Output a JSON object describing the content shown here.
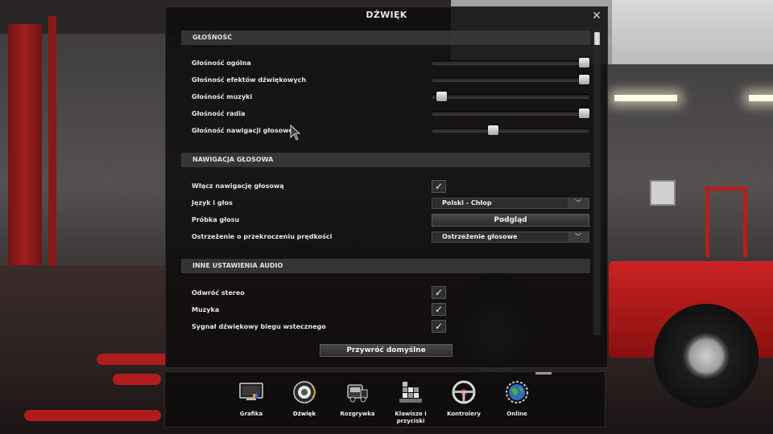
{
  "dialog": {
    "title": "DŹWIĘK",
    "close_glyph": "✕",
    "restore_label": "Przywróć domyślne"
  },
  "sections": {
    "volume": {
      "header": "GŁOŚNOŚĆ",
      "items": [
        {
          "label": "Głośność ogólna",
          "value": 1.0
        },
        {
          "label": "Głośność efektów dźwiękowych",
          "value": 1.0
        },
        {
          "label": "Głośność muzyki",
          "value": 0.03
        },
        {
          "label": "Głośność radia",
          "value": 1.0
        },
        {
          "label": "Głośność nawigacji głosowej",
          "value": 0.38
        }
      ]
    },
    "navigation": {
      "header": "NAWIGACJA GŁOSOWA",
      "enable_label": "Włącz nawigację głosową",
      "enable_checked": true,
      "language_label": "Język i głos",
      "language_value": "Polski - Chłop",
      "sample_label": "Próbka głosu",
      "preview_button": "Podgląd",
      "speed_warning_label": "Ostrzeżenie o przekroczeniu prędkości",
      "speed_warning_value": "Ostrzeżenie głosowe"
    },
    "other": {
      "header": "INNE USTAWIENIA AUDIO",
      "items": [
        {
          "label": "Odwróć stereo",
          "checked": true
        },
        {
          "label": "Muzyka",
          "checked": true
        },
        {
          "label": "Sygnał dźwiękowy biegu wstecznego",
          "checked": true
        }
      ]
    }
  },
  "tabs": [
    {
      "label": "Grafika",
      "icon": "monitor-icon"
    },
    {
      "label": "Dźwięk",
      "icon": "speaker-icon",
      "active": true
    },
    {
      "label": "Rozgrywka",
      "icon": "truck-icon"
    },
    {
      "label": "Klawisze i przyciski",
      "icon": "keyboard-icon"
    },
    {
      "label": "Kontrolery",
      "icon": "steering-wheel-icon"
    },
    {
      "label": "Online",
      "icon": "globe-icon"
    }
  ],
  "colors": {
    "dialog_bg": "#0e0c0c",
    "section_bg": "#3c3a3a",
    "text": "#e6e6e6",
    "accent_red": "#b01c1c"
  }
}
